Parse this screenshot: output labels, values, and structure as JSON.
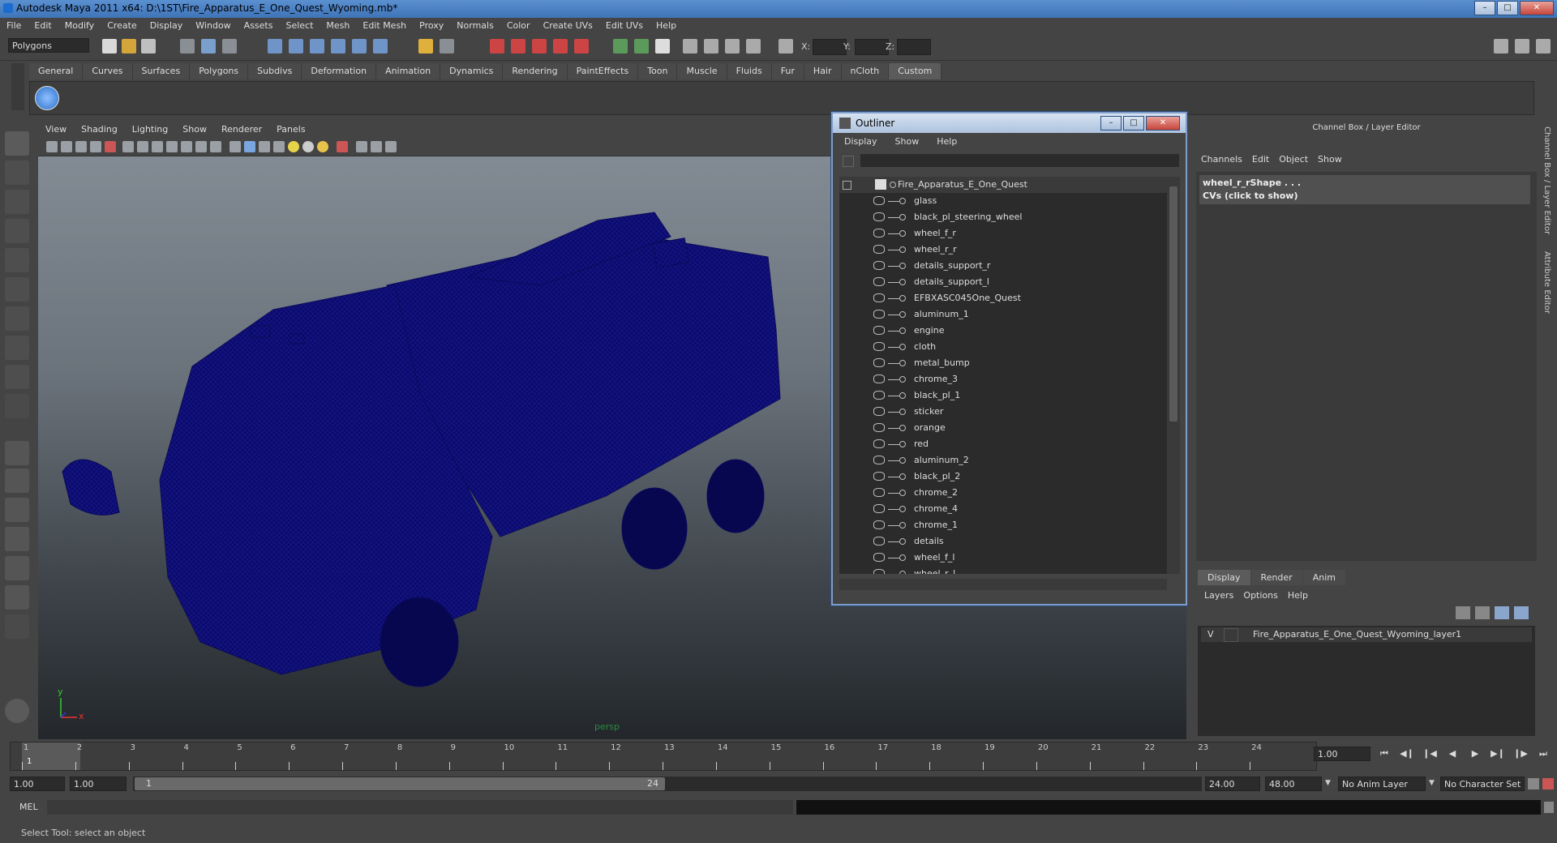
{
  "window": {
    "title": "Autodesk Maya 2011 x64: D:\\1ST\\Fire_Apparatus_E_One_Quest_Wyoming.mb*",
    "minimize": "–",
    "maximize": "□",
    "close": "✕"
  },
  "menubar": [
    "File",
    "Edit",
    "Modify",
    "Create",
    "Display",
    "Window",
    "Assets",
    "Select",
    "Mesh",
    "Edit Mesh",
    "Proxy",
    "Normals",
    "Color",
    "Create UVs",
    "Edit UVs",
    "Help"
  ],
  "toolbar": {
    "mode_select": "Polygons",
    "x_label": "X:",
    "y_label": "Y:",
    "z_label": "Z:"
  },
  "shelf_tabs": [
    "General",
    "Curves",
    "Surfaces",
    "Polygons",
    "Subdivs",
    "Deformation",
    "Animation",
    "Dynamics",
    "Rendering",
    "PaintEffects",
    "Toon",
    "Muscle",
    "Fluids",
    "Fur",
    "Hair",
    "nCloth",
    "Custom"
  ],
  "shelf_active": "Custom",
  "viewport": {
    "menu": [
      "View",
      "Shading",
      "Lighting",
      "Show",
      "Renderer",
      "Panels"
    ],
    "camera_label": "persp",
    "axis_x": "x",
    "axis_y": "y"
  },
  "outliner": {
    "title": "Outliner",
    "menu": [
      "Display",
      "Show",
      "Help"
    ],
    "root": "Fire_Apparatus_E_One_Quest",
    "items": [
      "glass",
      "black_pl_steering_wheel",
      "wheel_f_r",
      "wheel_r_r",
      "details_support_r",
      "details_support_l",
      "EFBXASC045One_Quest",
      "aluminum_1",
      "engine",
      "cloth",
      "metal_bump",
      "chrome_3",
      "black_pl_1",
      "sticker",
      "orange",
      "red",
      "aluminum_2",
      "black_pl_2",
      "chrome_2",
      "chrome_4",
      "chrome_1",
      "details",
      "wheel_f_l",
      "wheel_r_l"
    ]
  },
  "channel_box": {
    "title": "Channel Box / Layer Editor",
    "menu": [
      "Channels",
      "Edit",
      "Object",
      "Show"
    ],
    "object_name": "wheel_r_rShape . . .",
    "object_sub": "CVs (click to show)"
  },
  "layer_editor": {
    "tabs": [
      "Display",
      "Render",
      "Anim"
    ],
    "active_tab": "Display",
    "menu": [
      "Layers",
      "Options",
      "Help"
    ],
    "layer_visible": "V",
    "layer_name": "Fire_Apparatus_E_One_Quest_Wyoming_layer1"
  },
  "side_tabs": [
    "Channel Box / Layer Editor",
    "Attribute Editor"
  ],
  "time_slider": {
    "ticks": [
      "1",
      "2",
      "3",
      "4",
      "5",
      "6",
      "7",
      "8",
      "9",
      "10",
      "11",
      "12",
      "13",
      "14",
      "15",
      "16",
      "17",
      "18",
      "19",
      "20",
      "21",
      "22",
      "23",
      "24"
    ],
    "current_frame": "1",
    "frame_field": "1.00"
  },
  "range_slider": {
    "start": "1.00",
    "start_inner": "1.00",
    "thumb_start": "1",
    "thumb_end": "24",
    "end_inner": "24.00",
    "end": "48.00",
    "anim_layer": "No Anim Layer",
    "char_set": "No Character Set"
  },
  "command_line": {
    "label": "MEL"
  },
  "help_line": "Select Tool: select an object",
  "colors": {
    "truck_wire": "#0b0b6e",
    "title_bar": "#4a82c6",
    "viewport_top": "#868e97",
    "viewport_bottom": "#23272b"
  }
}
